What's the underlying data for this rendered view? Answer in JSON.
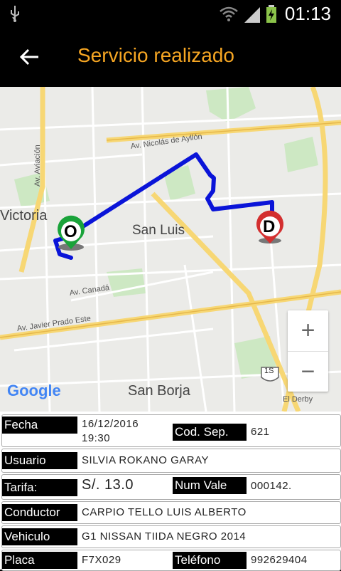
{
  "status_bar": {
    "time": "01:13",
    "icons": [
      "usb-icon",
      "wifi-icon",
      "signal-icon",
      "battery-charging-icon"
    ]
  },
  "app_bar": {
    "title": "Servicio realizado",
    "back_icon": "arrow-back-icon",
    "title_color": "#f6a623"
  },
  "map": {
    "districts": [
      "Victoria",
      "San Luis",
      "San Borja"
    ],
    "streets": [
      "Av. Nicolás de Ayllón",
      "Av. Aviación",
      "Av. Canadá",
      "Av. Javier Prado Este",
      "El Derby"
    ],
    "highway_shield": "1S",
    "origin_marker": "O",
    "destination_marker": "D",
    "route_color": "#0a14d8",
    "origin_color": "#1aa33a",
    "destination_color": "#d32f2f",
    "attribution": "Google",
    "zoom_in": "+",
    "zoom_out": "−"
  },
  "details": {
    "fecha_label": "Fecha",
    "fecha_date": "16/12/2016",
    "fecha_time": "19:30",
    "cod_sep_label": "Cod. Sep.",
    "cod_sep_value": "621",
    "usuario_label": "Usuario",
    "usuario_value": "SILVIA ROKANO GARAY",
    "tarifa_label": "Tarifa:",
    "tarifa_value": "S/. 13.0",
    "num_vale_label": "Num Vale",
    "num_vale_value": "000142.",
    "conductor_label": "Conductor",
    "conductor_value": "CARPIO TELLO LUIS ALBERTO",
    "vehiculo_label": "Vehiculo",
    "vehiculo_value": "G1 NISSAN TIIDA NEGRO 2014",
    "placa_label": "Placa",
    "placa_value": "F7X029",
    "telefono_label": "Teléfono",
    "telefono_value": "992629404"
  }
}
